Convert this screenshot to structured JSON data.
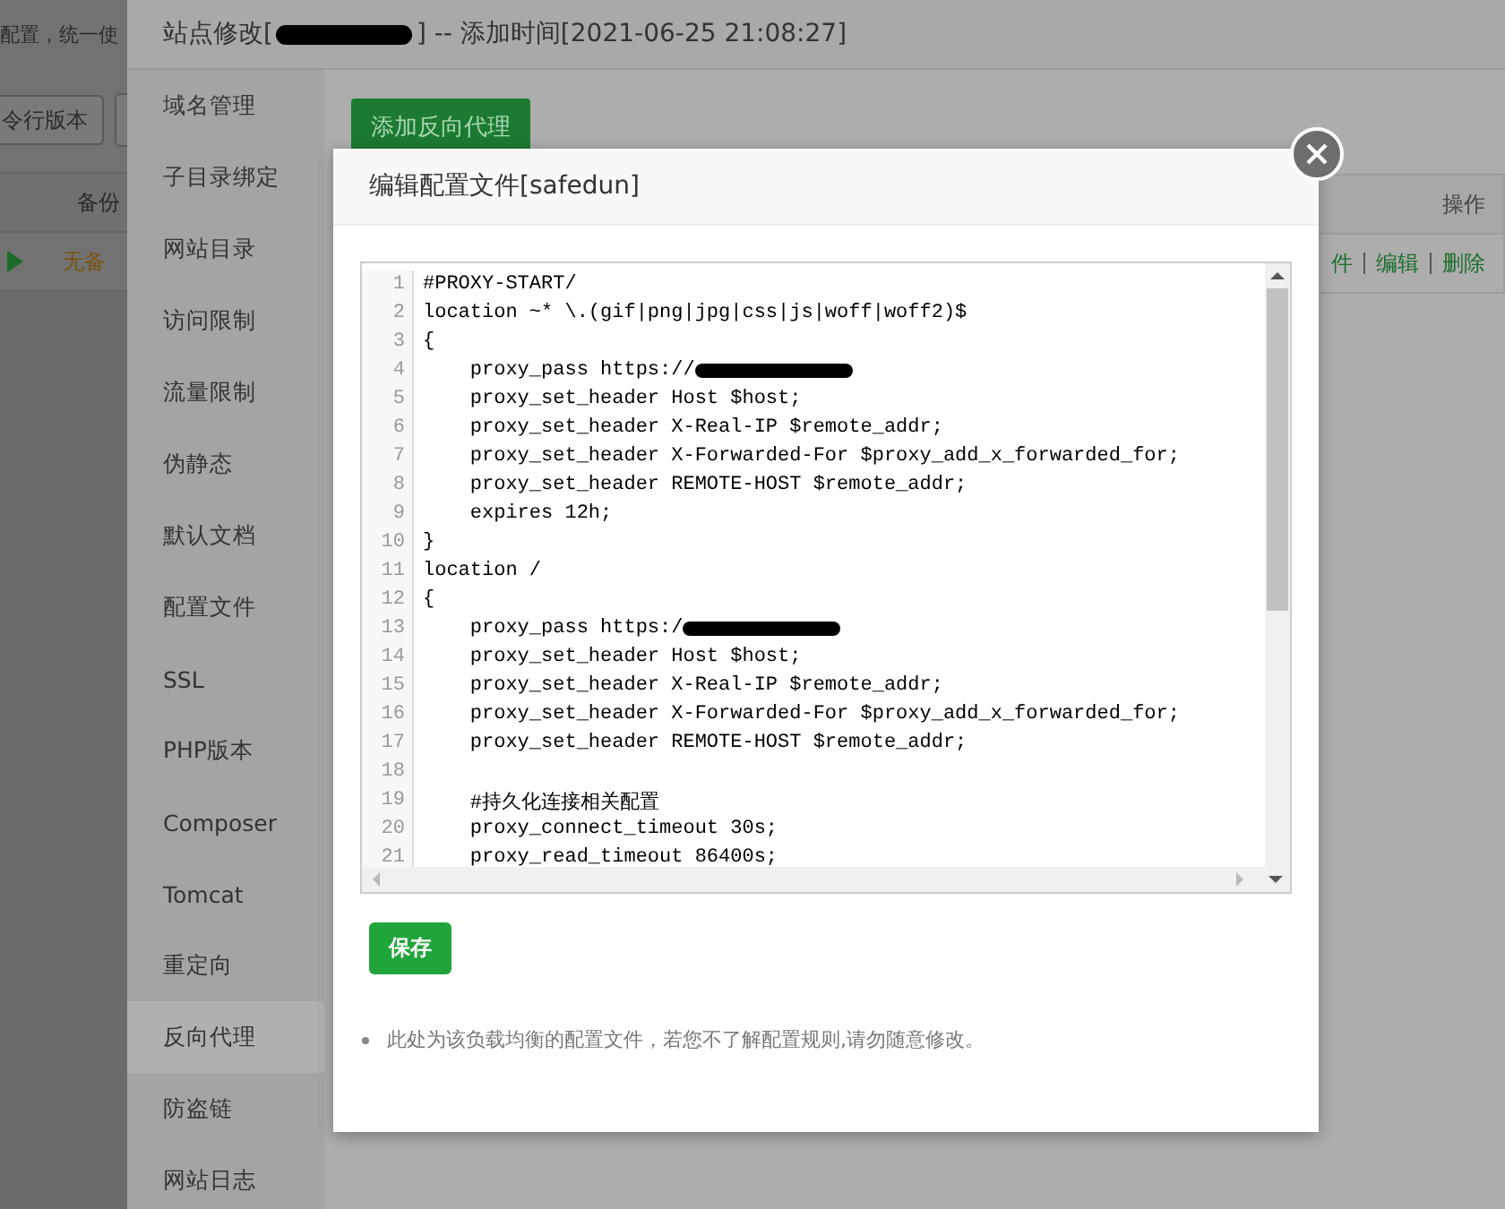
{
  "background_page": {
    "notice": "配置，统一使",
    "version_button": "令行版本",
    "table": {
      "columns": [
        "备份"
      ],
      "rows": [
        {
          "backup": "无备"
        }
      ]
    }
  },
  "site_edit": {
    "title_prefix": "站点修改[",
    "title_suffix": "] -- 添加时间[2021-06-25 21:08:27]",
    "menu": [
      {
        "label": "域名管理",
        "selected": false
      },
      {
        "label": "子目录绑定",
        "selected": false
      },
      {
        "label": "网站目录",
        "selected": false
      },
      {
        "label": "访问限制",
        "selected": false
      },
      {
        "label": "流量限制",
        "selected": false
      },
      {
        "label": "伪静态",
        "selected": false
      },
      {
        "label": "默认文档",
        "selected": false
      },
      {
        "label": "配置文件",
        "selected": false
      },
      {
        "label": "SSL",
        "selected": false
      },
      {
        "label": "PHP版本",
        "selected": false
      },
      {
        "label": "Composer",
        "selected": false
      },
      {
        "label": "Tomcat",
        "selected": false
      },
      {
        "label": "重定向",
        "selected": false
      },
      {
        "label": "反向代理",
        "selected": true
      },
      {
        "label": "防盗链",
        "selected": false
      },
      {
        "label": "网站日志",
        "selected": false
      }
    ],
    "add_button": "添加反向代理",
    "table": {
      "columns": [
        "操作"
      ],
      "row_actions": [
        "件",
        "编辑",
        "删除"
      ]
    }
  },
  "modal": {
    "title": "编辑配置文件[safedun]",
    "code_lines": [
      {
        "number": "1",
        "text": "#PROXY-START/",
        "redacted": false
      },
      {
        "number": "2",
        "text": "location ~* \\.(gif|png|jpg|css|js|woff|woff2)$",
        "redacted": false
      },
      {
        "number": "3",
        "text": "{",
        "redacted": false
      },
      {
        "number": "4",
        "text": "    proxy_pass https://",
        "redacted": true
      },
      {
        "number": "5",
        "text": "    proxy_set_header Host $host;",
        "redacted": false
      },
      {
        "number": "6",
        "text": "    proxy_set_header X-Real-IP $remote_addr;",
        "redacted": false
      },
      {
        "number": "7",
        "text": "    proxy_set_header X-Forwarded-For $proxy_add_x_forwarded_for;",
        "redacted": false
      },
      {
        "number": "8",
        "text": "    proxy_set_header REMOTE-HOST $remote_addr;",
        "redacted": false
      },
      {
        "number": "9",
        "text": "    expires 12h;",
        "redacted": false
      },
      {
        "number": "10",
        "text": "}",
        "redacted": false
      },
      {
        "number": "11",
        "text": "location /",
        "redacted": false
      },
      {
        "number": "12",
        "text": "{",
        "redacted": false
      },
      {
        "number": "13",
        "text": "    proxy_pass https:/",
        "redacted": true
      },
      {
        "number": "14",
        "text": "    proxy_set_header Host $host;",
        "redacted": false
      },
      {
        "number": "15",
        "text": "    proxy_set_header X-Real-IP $remote_addr;",
        "redacted": false
      },
      {
        "number": "16",
        "text": "    proxy_set_header X-Forwarded-For $proxy_add_x_forwarded_for;",
        "redacted": false
      },
      {
        "number": "17",
        "text": "    proxy_set_header REMOTE-HOST $remote_addr;",
        "redacted": false
      },
      {
        "number": "18",
        "redacted": false
      },
      {
        "number": "19",
        "text": "    #持久化连接相关配置",
        "redacted": false
      },
      {
        "number": "20",
        "text": "    proxy_connect_timeout 30s;",
        "redacted": false
      },
      {
        "number": "21",
        "text": "    proxy_read_timeout 86400s;",
        "redacted": false
      }
    ],
    "save_button": "保存",
    "note": "此处为该负载均衡的配置文件，若您不了解配置规则,请勿随意修改。"
  }
}
